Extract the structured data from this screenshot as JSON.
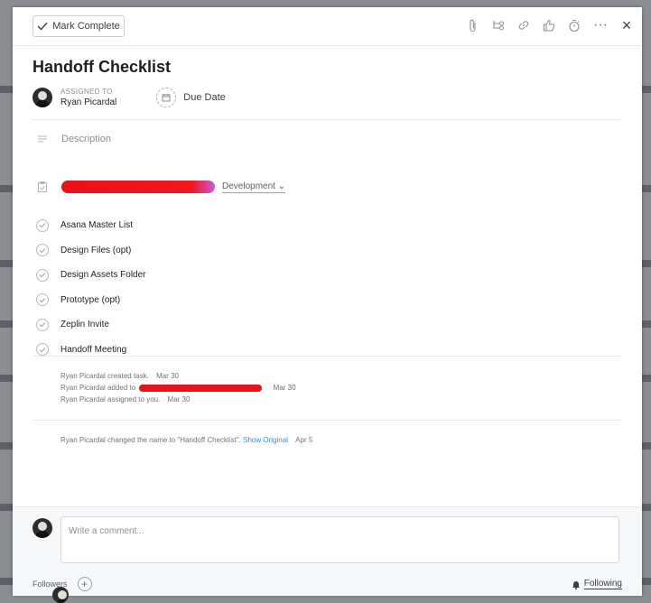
{
  "toolbar": {
    "mark_complete_label": "Mark Complete",
    "icons": [
      "attachment-icon",
      "subtask-icon",
      "link-icon",
      "like-icon",
      "timer-icon",
      "more-icon",
      "close-icon"
    ],
    "more_glyph": "···",
    "close_glyph": "×"
  },
  "task": {
    "title": "Handoff Checklist",
    "assigned_label": "ASSIGNED TO",
    "assignee": "Ryan Picardal",
    "due_label": "Due Date",
    "description_placeholder": "Description",
    "project_section": "Development ⌄"
  },
  "subtasks": [
    "Asana Master List",
    "Design Files (opt)",
    "Design Assets Folder",
    "Prototype (opt)",
    "Zeplin Invite",
    "Handoff Meeting"
  ],
  "activity": [
    {
      "who": "Ryan Picardal",
      "text": "created task.",
      "when": "Mar 30"
    },
    {
      "who": "Ryan Picardal",
      "text": "added to",
      "when": "Mar 30"
    },
    {
      "who": "Ryan Picardal",
      "text": "assigned to you.",
      "when": "Mar 30"
    }
  ],
  "history": {
    "who": "Ryan Picardal",
    "text": "changed the name to \"Handoff Checklist\".",
    "link": "Show Original",
    "when": "Apr 5"
  },
  "comment": {
    "placeholder": "Write a comment..."
  },
  "followers": {
    "label": "Followers",
    "add_glyph": "+",
    "following_label": "Following"
  },
  "colors": {
    "accent_link": "#2f8fd9",
    "redaction": "#e8101a"
  }
}
